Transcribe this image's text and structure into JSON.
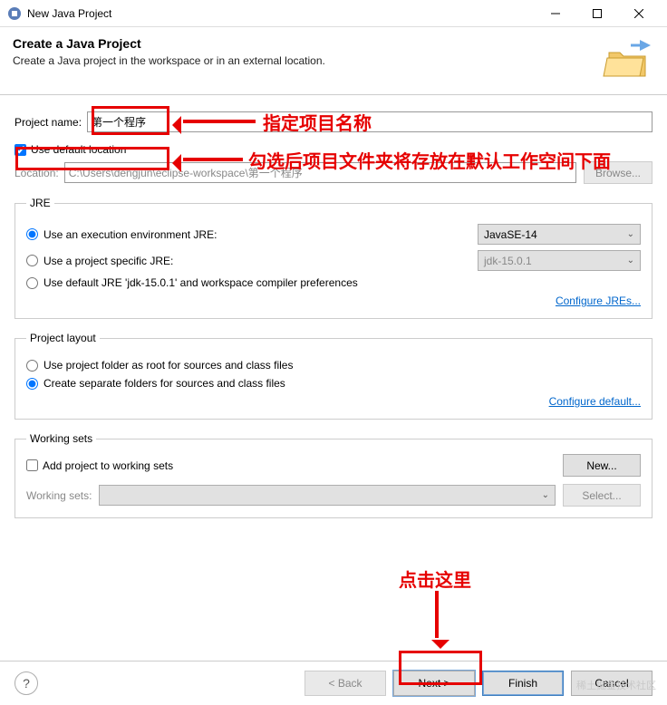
{
  "window": {
    "title": "New Java Project"
  },
  "banner": {
    "heading": "Create a Java Project",
    "description": "Create a Java project in the workspace or in an external location."
  },
  "project": {
    "name_label": "Project name:",
    "name_value": "第一个程序",
    "use_default_label": "Use default location",
    "use_default_checked": true,
    "location_label": "Location:",
    "location_value": "C:\\Users\\dengjun\\eclipse-workspace\\第一个程序",
    "browse_label": "Browse..."
  },
  "jre": {
    "legend": "JRE",
    "opt_env_label": "Use an execution environment JRE:",
    "env_value": "JavaSE-14",
    "opt_proj_label": "Use a project specific JRE:",
    "proj_value": "jdk-15.0.1",
    "opt_default_label": "Use default JRE 'jdk-15.0.1' and workspace compiler preferences",
    "configure_link": "Configure JREs..."
  },
  "layout": {
    "legend": "Project layout",
    "opt_root_label": "Use project folder as root for sources and class files",
    "opt_sep_label": "Create separate folders for sources and class files",
    "configure_link": "Configure default..."
  },
  "workingsets": {
    "legend": "Working sets",
    "add_label": "Add project to working sets",
    "new_label": "New...",
    "ws_label": "Working sets:",
    "select_label": "Select..."
  },
  "footer": {
    "back": "< Back",
    "next": "Next >",
    "finish": "Finish",
    "cancel": "Cancel"
  },
  "annotations": {
    "a1": "指定项目名称",
    "a2": "勾选后项目文件夹将存放在默认工作空间下面",
    "a3": "点击这里"
  },
  "watermark": "稀土掘金技术社区"
}
